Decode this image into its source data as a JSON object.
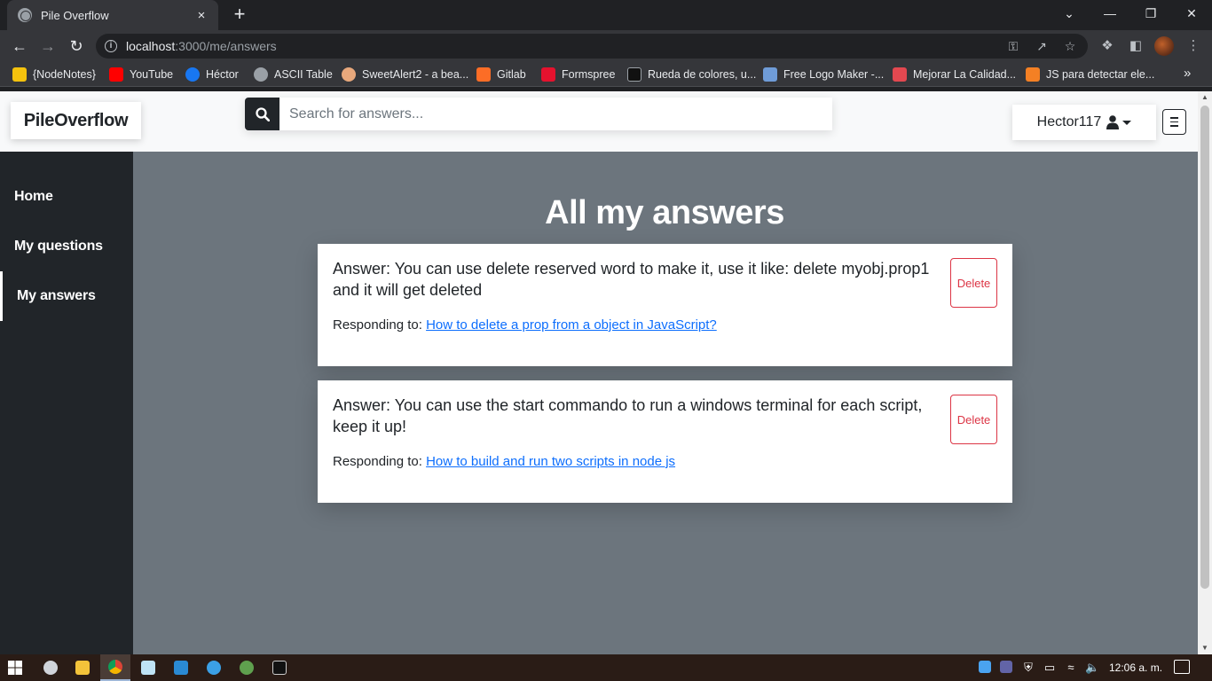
{
  "browser": {
    "tab_title": "Pile Overflow",
    "tab_close": "×",
    "new_tab": "+",
    "url_host": "localhost",
    "url_path": ":3000/me/answers",
    "window_controls": [
      "⌄",
      "—",
      "❐",
      "✕"
    ],
    "bookmarks": [
      {
        "label": "{NodeNotes}",
        "color": "#f4c20d"
      },
      {
        "label": "YouTube",
        "color": "#ff0000"
      },
      {
        "label": "Héctor",
        "color": "#1877f2"
      },
      {
        "label": "ASCII Table",
        "color": "#9aa0a6"
      },
      {
        "label": "SweetAlert2 - a bea...",
        "color": "#e8a87c"
      },
      {
        "label": "Gitlab",
        "color": "#fc6d26"
      },
      {
        "label": "Formspree",
        "color": "#e5122e"
      },
      {
        "label": "Rueda de colores, u...",
        "color": "#111111"
      },
      {
        "label": "Free Logo Maker -...",
        "color": "#6f9cd8"
      },
      {
        "label": "Mejorar La Calidad...",
        "color": "#e34850"
      },
      {
        "label": "JS para detectar ele...",
        "color": "#f48024"
      }
    ],
    "bookmarks_more": "»"
  },
  "navbar": {
    "brand": "PileOverflow",
    "search_placeholder": "Search for answers...",
    "username": "Hector117"
  },
  "sidebar": {
    "items": [
      {
        "label": "Home",
        "active": false
      },
      {
        "label": "My questions",
        "active": false
      },
      {
        "label": "My answers",
        "active": true
      }
    ]
  },
  "main": {
    "title": "All my answers",
    "answers": [
      {
        "text": "Answer: You can use delete reserved word to make it, use it like: delete myobj.prop1 and it will get deleted",
        "responding_label": "Responding to:",
        "question_link": "How to delete a prop from a object in JavaScript?",
        "delete_label": "Delete"
      },
      {
        "text": "Answer: You can use the start commando to run a windows terminal for each script, keep it up!",
        "responding_label": "Responding to:",
        "question_link": "How to build and run two scripts in node js",
        "delete_label": "Delete"
      }
    ]
  },
  "taskbar": {
    "clock": "12:06 a. m."
  },
  "colors": {
    "page_bg": "#6c757d",
    "sidebar_bg": "#212529",
    "delete": "#dc3545",
    "link": "#0d6efd"
  }
}
